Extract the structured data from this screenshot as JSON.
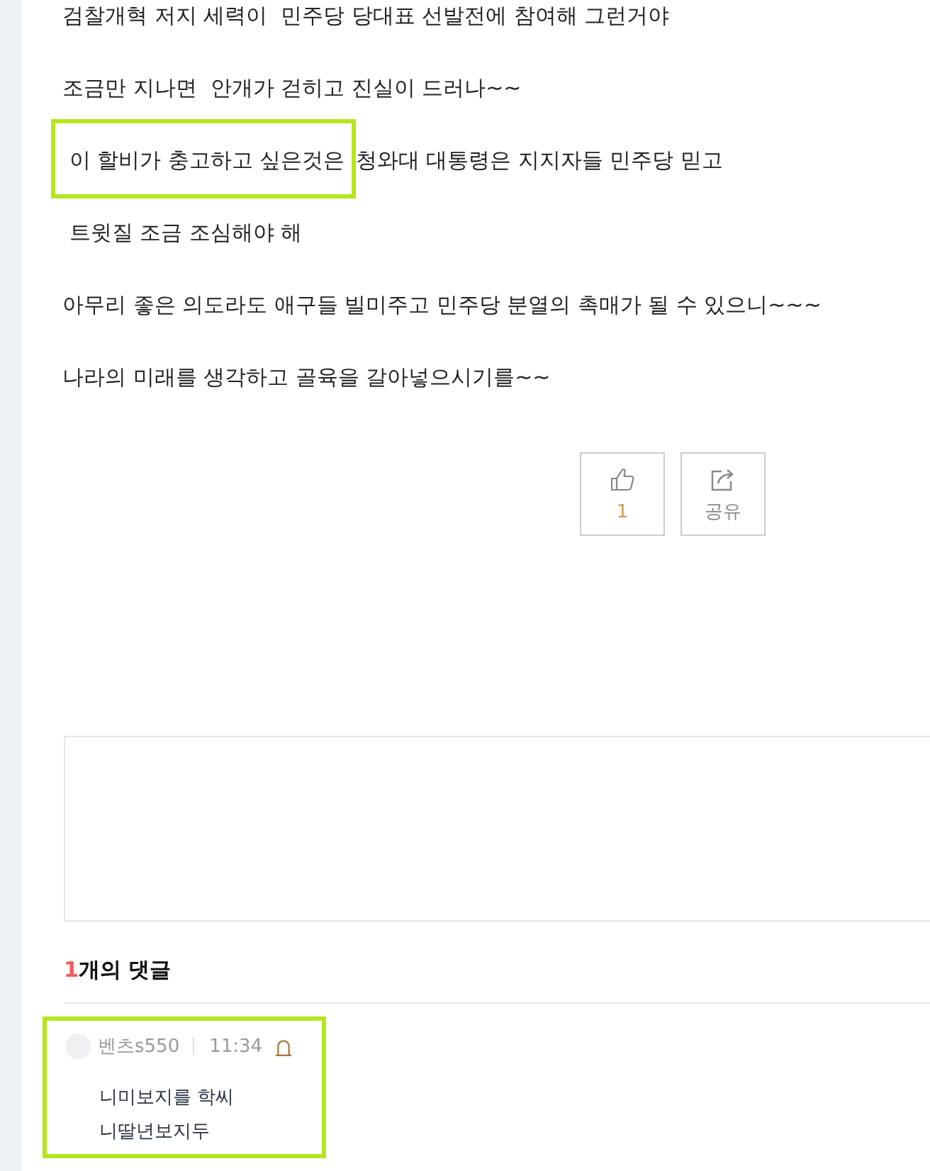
{
  "post": {
    "paragraphs": [
      {
        "segments": [
          {
            "text": "검찰개혁 저지 세력이  민주당 당대표 선발전에 참여해 그런거야",
            "highlighted": false
          }
        ]
      },
      {
        "segments": [
          {
            "text": "조금만 지나면  안개가 걷히고 진실이 드러나~~",
            "highlighted": false
          }
        ]
      },
      {
        "segments": [
          {
            "text": " 이 할비가 충고하고 싶은것은 ",
            "highlighted": true
          },
          {
            "text": "청와대 대통령은 지지자들 민주당 믿고",
            "highlighted": false
          }
        ]
      },
      {
        "segments": [
          {
            "text": " 트윗질 조금 조심해야 해",
            "highlighted": false
          }
        ]
      },
      {
        "segments": [
          {
            "text": "아무리 좋은 의도라도 애구들 빌미주고 민주당 분열의 촉매가 될 수 있으니~~~",
            "highlighted": false
          }
        ]
      },
      {
        "segments": [
          {
            "text": "나라의 미래를 생각하고 골육을 갈아넣으시기를~~",
            "highlighted": false
          }
        ]
      }
    ]
  },
  "actions": [
    {
      "kind": "like",
      "label": "1"
    },
    {
      "kind": "share",
      "label": "공유"
    }
  ],
  "comments_section": {
    "count": "1",
    "label": "개의 댓글"
  },
  "comments": [
    {
      "author": "벤츠s550",
      "time": "11:34",
      "lines": [
        "니미보지를 학씨",
        "니딸년보지두"
      ],
      "highlighted": true
    }
  ]
}
